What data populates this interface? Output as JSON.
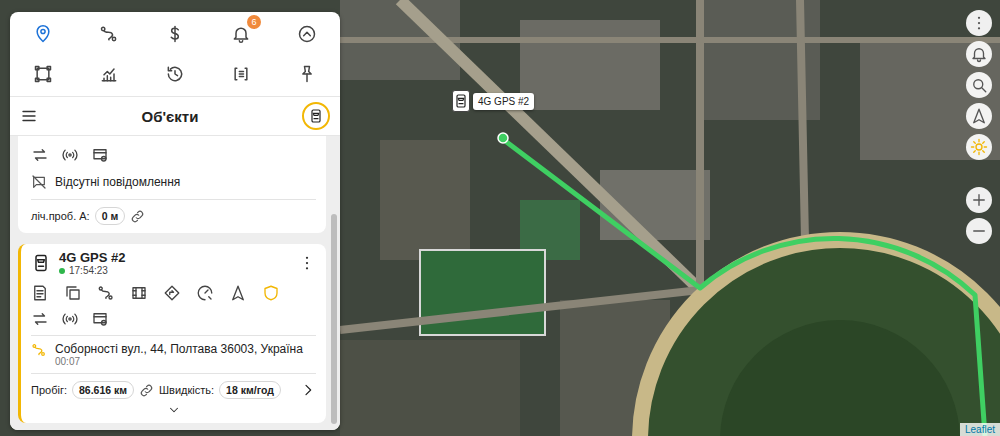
{
  "toolbar": {
    "buttons": [
      {
        "kind": "location",
        "selected": true
      },
      {
        "kind": "route",
        "selected": false
      },
      {
        "kind": "dollar",
        "selected": false
      },
      {
        "kind": "bell",
        "selected": false,
        "badge": "6"
      },
      {
        "kind": "collapse",
        "selected": false
      },
      {
        "kind": "area",
        "selected": false
      },
      {
        "kind": "chart",
        "selected": false
      },
      {
        "kind": "history",
        "selected": false
      },
      {
        "kind": "list",
        "selected": false
      },
      {
        "kind": "pin",
        "selected": false
      }
    ]
  },
  "panel": {
    "title": "Об'єкти"
  },
  "objects": [
    {
      "kind": "partial",
      "selected": false,
      "actions": [
        {
          "kind": "swap"
        },
        {
          "kind": "broadcast"
        },
        {
          "kind": "window"
        }
      ],
      "message": "Відсутні повідомлення",
      "counter_label": "ліч.проб. А:",
      "counter_value": "0 м"
    },
    {
      "kind": "full",
      "selected": true,
      "name": "4G GPS #2",
      "online": true,
      "time": "17:54:23",
      "actions": [
        {
          "kind": "report"
        },
        {
          "kind": "copy"
        },
        {
          "kind": "route"
        },
        {
          "kind": "film"
        },
        {
          "kind": "diamond"
        },
        {
          "kind": "speedo"
        },
        {
          "kind": "arrow"
        },
        {
          "kind": "shield"
        }
      ],
      "actions2": [
        {
          "kind": "swap"
        },
        {
          "kind": "broadcast"
        },
        {
          "kind": "window"
        }
      ],
      "address": "Соборності вул., 44, Полтава 36003, Україна",
      "address_time": "00:07",
      "mileage_label": "Пробіг:",
      "mileage": "86.616 км",
      "speed_label": "Швидкість:",
      "speed": "18 км/год"
    }
  ],
  "map": {
    "marker": {
      "label": "4G GPS #2"
    },
    "controls": [
      {
        "kind": "kebab"
      },
      {
        "kind": "bell"
      },
      {
        "kind": "search"
      },
      {
        "kind": "arrow"
      },
      {
        "kind": "sun"
      },
      {
        "kind": "plus"
      },
      {
        "kind": "minus"
      }
    ],
    "attribution": "Leaflet"
  }
}
